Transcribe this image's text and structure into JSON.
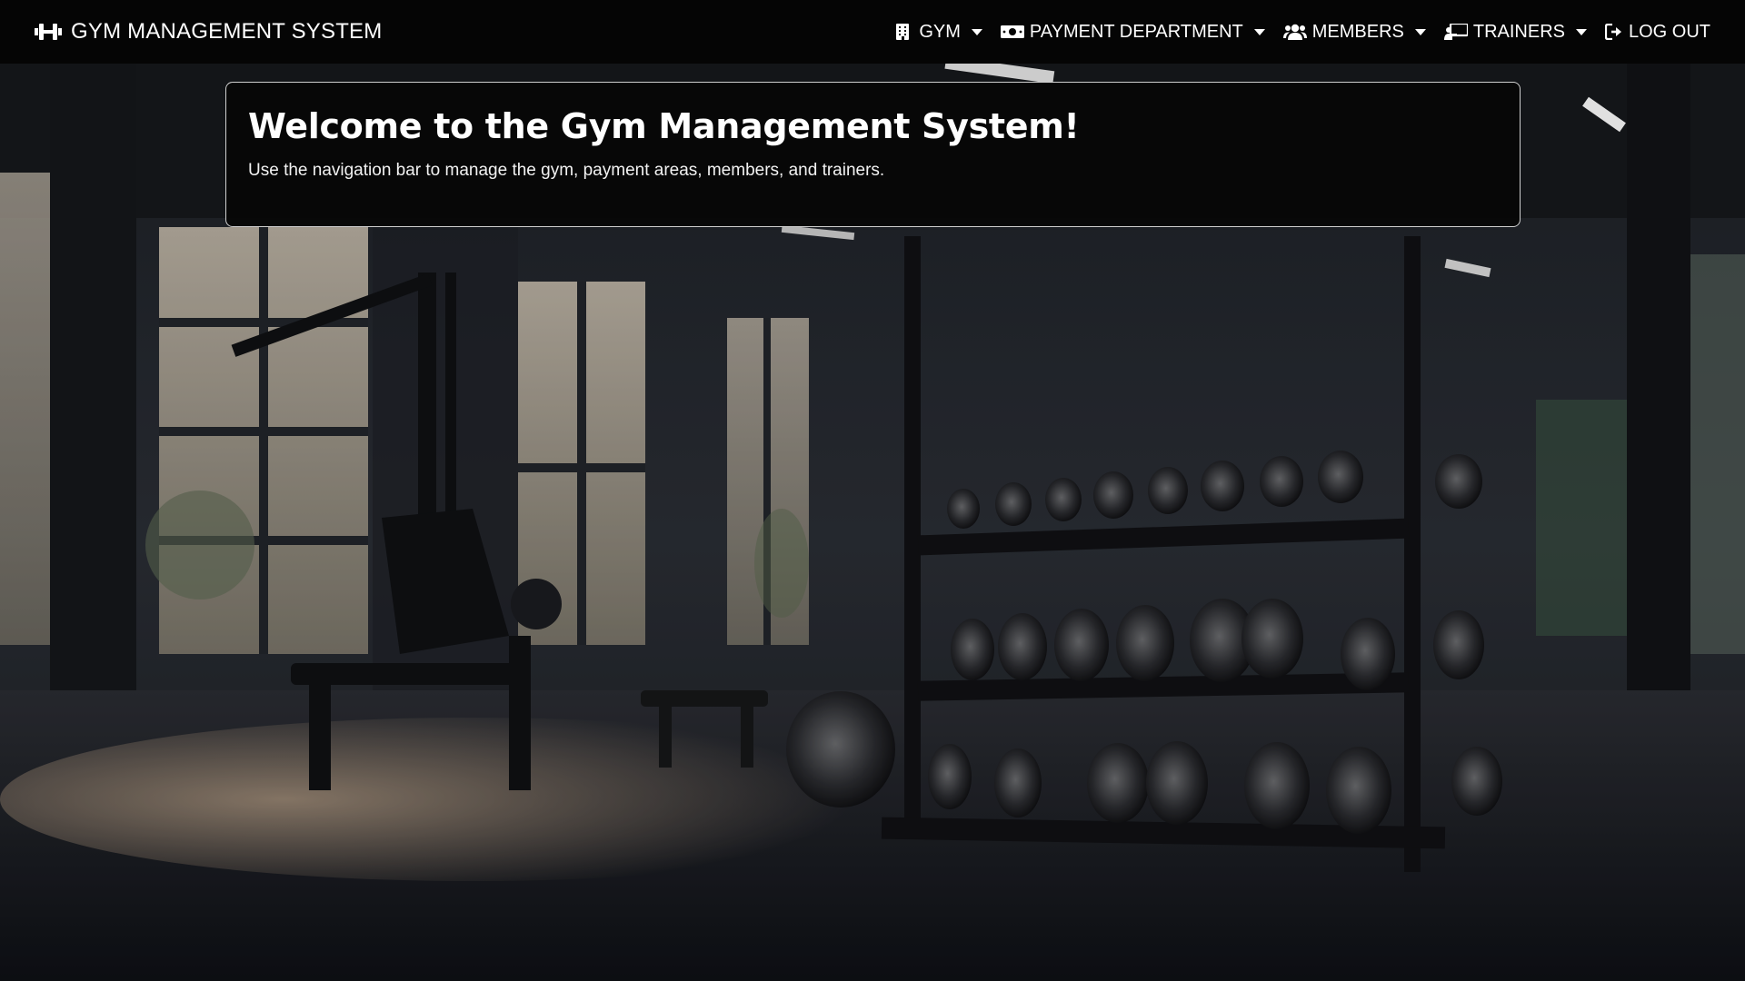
{
  "brand": {
    "icon": "dumbbell-icon",
    "title": "GYM MANAGEMENT SYSTEM"
  },
  "nav": {
    "items": [
      {
        "label": "GYM",
        "icon": "building-icon",
        "dropdown": true
      },
      {
        "label": "PAYMENT DEPARTMENT",
        "icon": "money-bill-icon",
        "dropdown": true
      },
      {
        "label": "MEMBERS",
        "icon": "users-icon",
        "dropdown": true
      },
      {
        "label": "TRAINERS",
        "icon": "chalkboard-teacher-icon",
        "dropdown": true
      },
      {
        "label": "LOG OUT",
        "icon": "sign-out-icon",
        "dropdown": false
      }
    ]
  },
  "welcome": {
    "heading": "Welcome to the Gym Management System!",
    "text": "Use the navigation bar to manage the gym, payment areas, members, and trainers."
  },
  "colors": {
    "navbar_bg": "#050505",
    "card_bg": "#060606",
    "card_border": "#cfcfcf",
    "text": "#ffffff"
  }
}
